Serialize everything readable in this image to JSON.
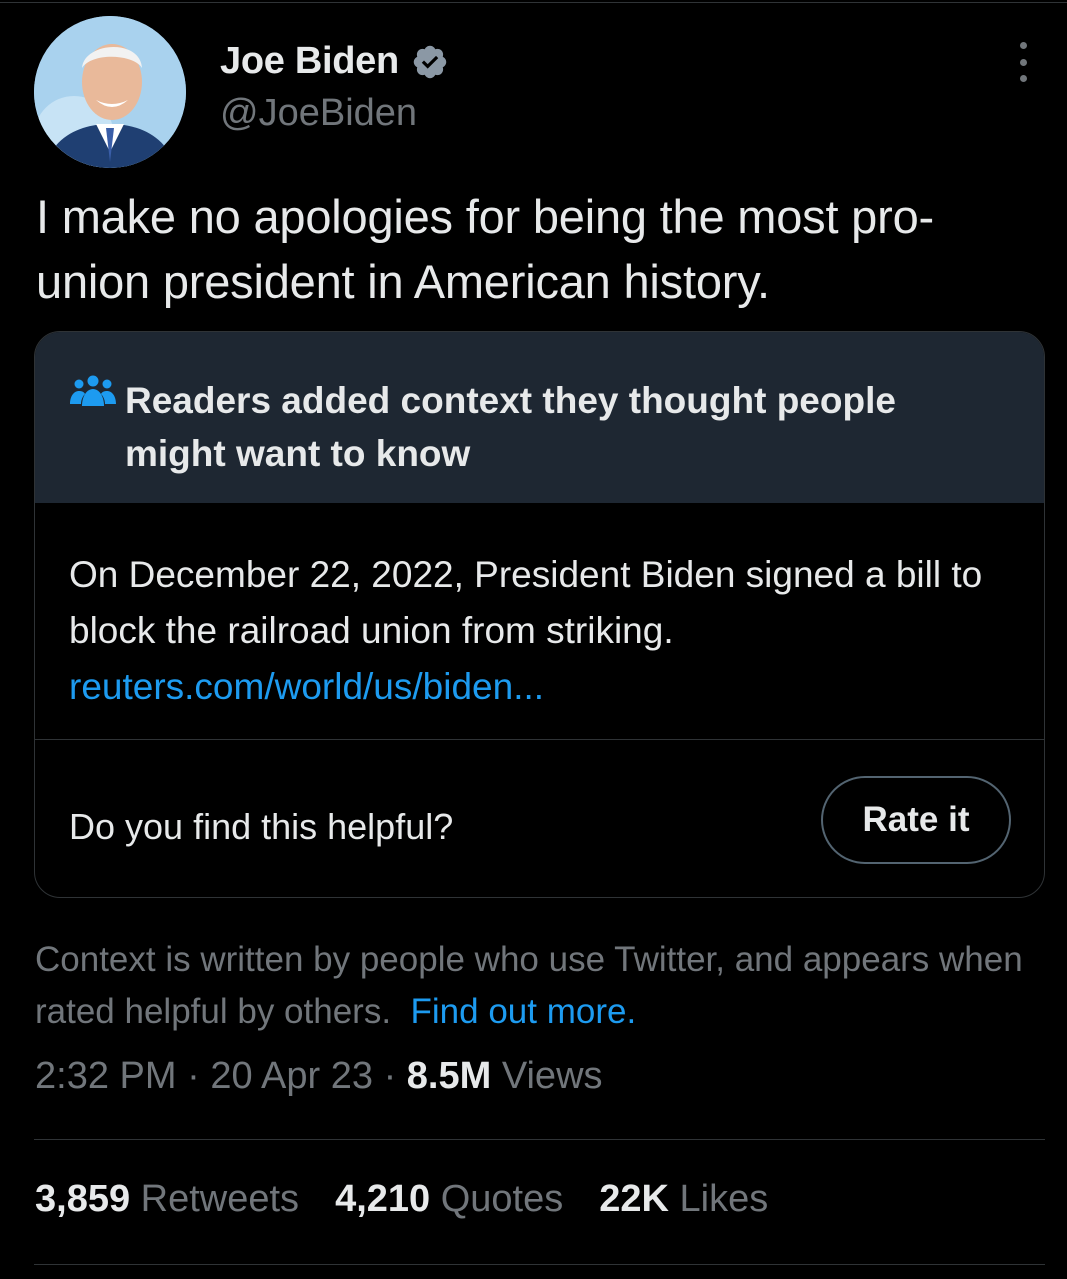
{
  "author": {
    "display_name": "Joe Biden",
    "handle": "@JoeBiden",
    "verified_color": "#8b98a5"
  },
  "tweet": {
    "text": "I make no apologies for being the most pro-union president in American history."
  },
  "community_note": {
    "title": "Readers added context they thought people might want to know",
    "body": "On December 22, 2022, President Biden signed a bill to block the railroad union from striking.",
    "link": "reuters.com/world/us/biden...",
    "helpful_question": "Do you find this helpful?",
    "rate_label": "Rate it"
  },
  "context_info": {
    "text": "Context is written by people who use Twitter, and appears when rated helpful by others.",
    "link": "Find out more."
  },
  "meta": {
    "time": "2:32 PM",
    "date": "20 Apr 23",
    "views_count": "8.5M",
    "views_label": "Views"
  },
  "stats": [
    {
      "count": "3,859",
      "label": "Retweets"
    },
    {
      "count": "4,210",
      "label": "Quotes"
    },
    {
      "count": "22K",
      "label": "Likes"
    }
  ],
  "colors": {
    "background": "#000000",
    "note_header": "#1e2732",
    "link": "#1d9bf0",
    "secondary_text": "#71767b"
  }
}
